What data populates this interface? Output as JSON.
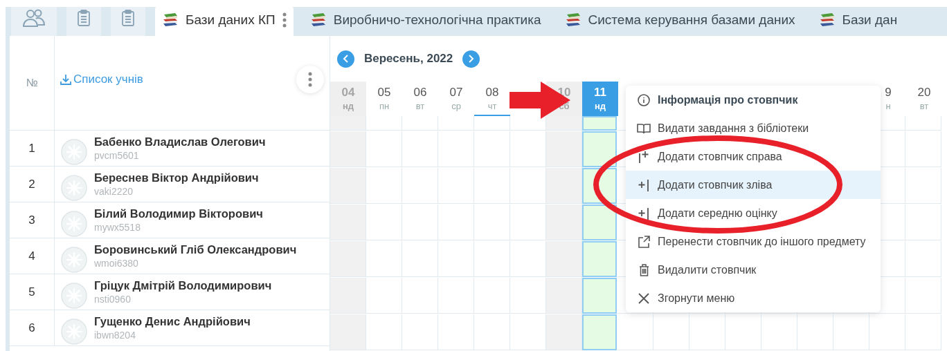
{
  "tool_tabs": [
    {
      "selected": false
    },
    {
      "selected": false
    },
    {
      "selected": false
    }
  ],
  "subject_tabs": [
    {
      "label": "Бази даних КП",
      "selected": true
    },
    {
      "label": "Виробничо-технологічна практика",
      "selected": false
    },
    {
      "label": "Система керування базами даних",
      "selected": false
    },
    {
      "label": "Бази дан",
      "selected": false
    }
  ],
  "student_list": {
    "number_header": "№",
    "title": "Список учнів"
  },
  "students": [
    {
      "number": "1",
      "name": "Бабенко Владислав Олегович",
      "login": "pvcm5601"
    },
    {
      "number": "2",
      "name": "Береснев Віктор Андрійович",
      "login": "vaki2220"
    },
    {
      "number": "3",
      "name": "Білий Володимир Вікторович",
      "login": "mywx5518"
    },
    {
      "number": "4",
      "name": "Боровинський Гліб Олександрович",
      "login": "wmoi6380"
    },
    {
      "number": "5",
      "name": "Гріцук Дмітрій Володимирович",
      "login": "nsti0960"
    },
    {
      "number": "6",
      "name": "Гущенко Денис Андрійович",
      "login": "ibwn8204"
    }
  ],
  "calendar": {
    "month": "Вересень, 2022",
    "days": [
      {
        "day": "04",
        "weekday": "нд",
        "weekend": true,
        "today": false,
        "selected": false
      },
      {
        "day": "05",
        "weekday": "пн",
        "weekend": false,
        "today": false,
        "selected": false
      },
      {
        "day": "06",
        "weekday": "вт",
        "weekend": false,
        "today": false,
        "selected": false
      },
      {
        "day": "07",
        "weekday": "ср",
        "weekend": false,
        "today": false,
        "selected": false
      },
      {
        "day": "08",
        "weekday": "чт",
        "weekend": false,
        "today": true,
        "selected": false
      },
      {
        "weekend": false,
        "today": false,
        "selected": false
      },
      {
        "day": "10",
        "weekday": "сб",
        "weekend": true,
        "today": false,
        "selected": false
      },
      {
        "day": "11",
        "weekday": "нд",
        "weekend": false,
        "today": false,
        "selected": true
      },
      {
        "day": "9",
        "weekday": "н",
        "weekend": false,
        "today": false,
        "selected": false,
        "kind": "after_menu"
      },
      {
        "day": "20",
        "weekday": "вт",
        "weekend": false,
        "today": false,
        "selected": false,
        "kind": "after_menu"
      }
    ]
  },
  "column_menu": {
    "items": [
      {
        "kind": "info",
        "label": "Інформація про стовпчик",
        "selected": false
      },
      {
        "kind": "library",
        "label": "Видати завдання з бібліотеки",
        "selected": false
      },
      {
        "kind": "add_right",
        "label": "Додати стовпчик справа",
        "selected": false
      },
      {
        "kind": "add_left",
        "label": "Додати стовпчик зліва",
        "selected": true
      },
      {
        "kind": "average",
        "label": "Додати середню оцінку",
        "selected": false
      },
      {
        "kind": "move",
        "label": "Перенести стовпчик до іншого предмету",
        "selected": false
      },
      {
        "kind": "delete",
        "label": "Видалити стовпчик",
        "selected": false
      },
      {
        "kind": "close",
        "label": "Згорнути меню",
        "selected": false
      }
    ]
  }
}
